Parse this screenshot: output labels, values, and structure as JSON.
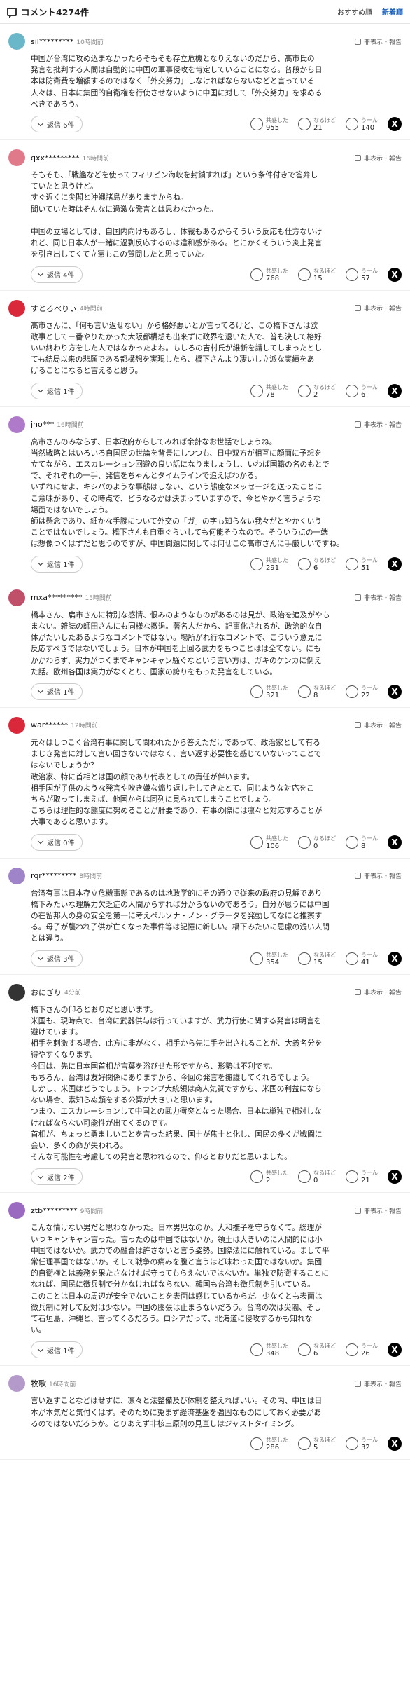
{
  "header": {
    "title": "コメント4274件",
    "sort_recommended": "おすすめ順",
    "sort_newest": "新着順"
  },
  "labels": {
    "flag": "非表示・報告",
    "r1": "共感した",
    "r2": "なるほど",
    "r3": "うーん",
    "share": "X"
  },
  "comments": [
    {
      "user": "sil*********",
      "time": "10時間前",
      "avatar_color": "#6ab7c9",
      "text": "中国が台湾に攻め込まなかったらそもそも存立危機となりえないのだから、高市氏の\n発言を批判する人間は自動的に中国の軍事侵攻を肯定していることになる。普段から日\n本は防衛費を増額するのではなく「外交努力」しなければならないなどと言っている\n人々は、日本に集団的自衛権を行使させないように中国に対して「外交努力」を求める\nべきであろう。",
      "replies": "返信 6件",
      "r1": "955",
      "r2": "21",
      "r3": "140"
    },
    {
      "user": "qxx*********",
      "time": "16時間前",
      "avatar_color": "#e07a8a",
      "text": "そもそも、「戦艦などを使ってフィリピン海峡を封鎖すれば」という条件付きで答弁し\nていたと思うけど。\nすぐ近くに尖閣と沖縄諸島がありますからね。\n聞いていた時はそんなに過激な発言とは思わなかった。\n\n中国の立場としては、自国内向けもあるし、体裁もあるからそういう反応も仕方ないけ\nれど、同じ日本人が一緒に過剰反応するのは違和感がある。とにかくそういう炎上発言\nを引き出してくて立憲もこの質問したと思っていた。",
      "replies": "返信 4件",
      "r1": "768",
      "r2": "15",
      "r3": "57"
    },
    {
      "user": "すとろべりぃ",
      "time": "4時間前",
      "avatar_color": "#d8283a",
      "text": "高市さんに、「何も言い返せない」から格好悪いとか言ってるけど、この橋下さんは欧\n政事としてー番やりたかった大阪都構想も出来ずに政界を退いた人で、普も決して格好\nいい終わり方をした人ではなかったよね。もしろの吉村氏が維新を請してしまったとし\nても結局以来の悲願である都構想を実現したら、橋下さんより凄いし立派な実績をあ\nげることになると言えると思う。",
      "replies": "返信 1件",
      "r1": "78",
      "r2": "2",
      "r3": "6"
    },
    {
      "user": "jho***",
      "time": "16時間前",
      "avatar_color": "#b07acb",
      "text": "高市さんのみならず、日本政府からしてみれば余計なお世話でしょうね。\n当然戦略とはいろいろ自国民の世論を背景にしつつも、日中双方が相互に顔面に予想を\n立てながら、エスカレーション回避の良い話になりましょうし、いわば国籍の名のもとで\nで、それぞれの一手、発信をちゃんとタイムラインで追えばわかる。\nいずれにせよ、キシパのような事態はしない、という態度なメッセージを送ったことに\nこ意味があり、その時点で、どうなるかは決まっていますので、今とやかく言うような\n場面ではないでしょう。\n師は懸念であり、細かな手腕について外交の「ガ」の字も知らない我々がとやかくいう\nことではないでしょう。橋下さんも自重ぐらいしても何能そうなので。そういう点の一端\nは想像つくはずだと思うのですが、中国問題に関しては何せこの高市さんに手厳しいですね。",
      "replies": "返信 1件",
      "r1": "291",
      "r2": "6",
      "r3": "51"
    },
    {
      "user": "mxa*********",
      "time": "15時間前",
      "avatar_color": "#c0506a",
      "text": "橋本さん、扁市さんに特別な感情、恨みのようなものがあるのは見が、政治を追及がやも\nまない。雑誌の師田さんにも同様な撤退。著名人だから、記事化されるが、政治的な自\n体がたいしたあるようなコメントではない。場所がれ行なコメントで、こういう意見に\n反応すべきではないでしょう。日本が中国を上回る武力をもつことはは全てない。にも\nかかわらず、実力がつくまでキャンキャン騒ぐなという言い方は、ガキのケンカに例え\nた話。欧州各国は実力がなくとり、国家の誇りをもった発言をしている。",
      "replies": "返信 1件",
      "r1": "321",
      "r2": "8",
      "r3": "22"
    },
    {
      "user": "war******",
      "time": "12時間前",
      "avatar_color": "#d8283a",
      "text": "元々はしつこく台湾有事に関して問われたから答えただけであって、政治家として有る\nまじき発言に対して言い回さないではなく、言い返す必要性を感じていないってことで\nはないでしょうか？\n政治家、特に首相とは国の顔であり代表としての責任が伴います。\n相手国が子供のような発言や吹き嫌な煽り返しをしてきたとて、同じような対応をこ\nちらが取ってしまえば、他国からは同列に見られてしまうことでしょう。\nこちらは理性的な態度に努めることが肝要であり、有事の際には凛々と対応することが\n大事であると思います。",
      "replies": "返信 0件",
      "r1": "106",
      "r2": "0",
      "r3": "8"
    },
    {
      "user": "rqr*********",
      "time": "8時間前",
      "avatar_color": "#a084c9",
      "text": "台湾有事は日本存立危機事態であるのは地政学的にその通りで従来の政府の見解であり\n橋下みたいな理解力欠乏症の人間からすれば分からないのであろう。自分が思うには中国\nの在留邦人の身の安全を第一に考えペルソナ・ノン・グラータを発動してなにと推察す\nる。母子が襲われ子供が亡くなった事件等は記憶に新しい。橋下みたいに思慮の浅い人間\nとは違う。",
      "replies": "返信 3件",
      "r1": "354",
      "r2": "15",
      "r3": "41"
    },
    {
      "user": "おにぎり",
      "time": "4分前",
      "avatar_color": "#333333",
      "text": "橋下さんの仰るとおりだと思います。\n米国も、現時点で、台湾に武器供与は行っていますが、武力行使に関する発言は明言を\n避けています。\n相手を刺激する場合、此方に非がなく、相手から先に手を出されることが、大義名分を\n得やすくなります。\n今回は、先に日本国首相が言葉を浴びせた形ですから、形勢は不利です。\nもちろん、台湾は友好関係にありますから、今回の発言を擁護してくれるでしょう。\nしかし、米国はどうでしょう。トランプ大統領は商人気質ですから、米国の利益になら\nない場合、素知らぬ顔をする公算が大きいと思います。\nつまり、エスカレーションして中国との武力衝突となった場合、日本は単独で相対しな\nければならない可能性が出てくるのです。\n首相が、ちょっと勇ましいことを言った結果、国土が焦土と化し、国民の多くが戦闘に\n会い、多くの命が失われる。\nそんな可能性を考慮しての発言と思われるので、仰るとおりだと思いました。",
      "replies": "返信 2件",
      "r1": "2",
      "r2": "0",
      "r3": "21"
    },
    {
      "user": "ztb*********",
      "time": "9時間前",
      "avatar_color": "#9a6ac0",
      "text": "こんな情けない男だと思わなかった。日本男児なのか。大和撫子を守らなくて。総理が\nいつキャンキャン言った。言ったのは中国ではないか。領土は大きいのに人間的には小\n中国ではないか。武力での融合は許さないと言う姿勢。国際法にに触れている。まして平\n常任理事国ではないか。そして戦争の痛みを腹と言うほど味わった国ではないか。集団\n的自衛権とは義務を果たさなければ守ってもらえないではないか。単独で防衛することに\nなれば、国民に徴兵制で分かなければならない。韓国も台湾も徴兵制を引いている。\nこのことは日本の周辺が安全でないことを表面は感じているからだ。少なくとも表面は\n徴兵制に対して反対は少ない。中国の膨張は止まらないだろう。台湾の次は尖閣、そし\nて石垣島、沖縄と、言ってくるだろう。ロシアだって、北海道に侵攻するかも知れな\nい。",
      "replies": "返信 1件",
      "r1": "348",
      "r2": "6",
      "r3": "26"
    },
    {
      "user": "牧歌",
      "time": "16時間前",
      "avatar_color": "#b49acb",
      "text": "言い返すことなどはせずに、凛々と法整備及び体制を整えればいい。その内、中国は日\n本が本気だと気付くはず。そのために兎まず経済基盤を強固なものにしておく必要があ\nるのではないだろうか。とりあえず非核三原則の見直しはジャストタイミング。",
      "replies": "",
      "r1": "286",
      "r2": "5",
      "r3": "32"
    }
  ]
}
